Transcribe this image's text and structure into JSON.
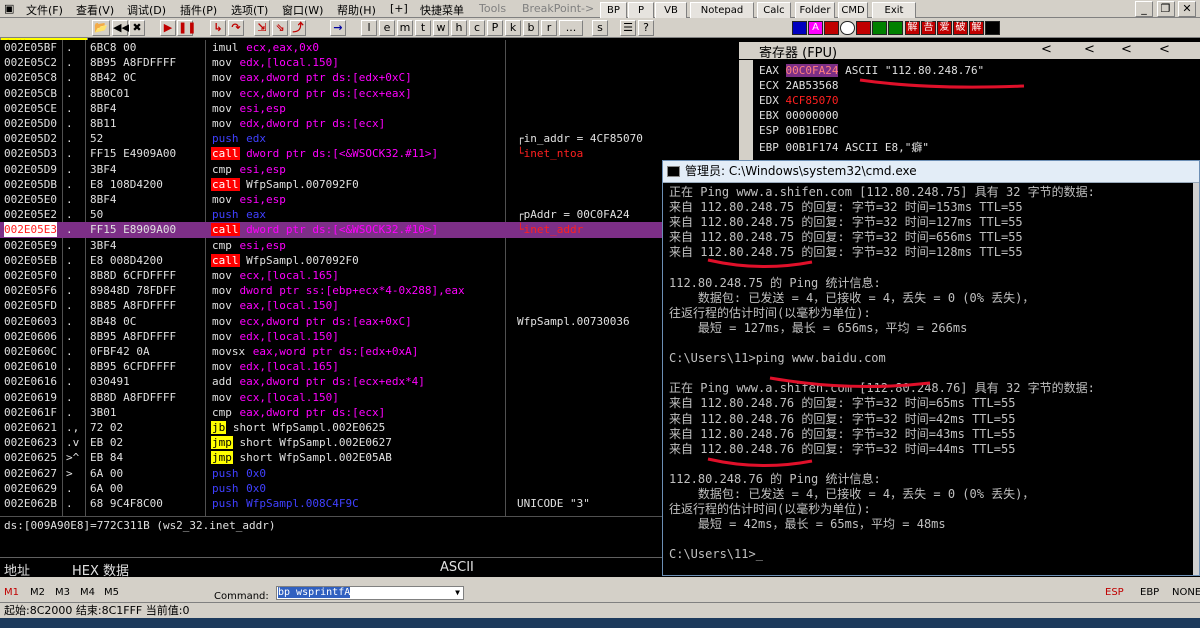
{
  "menubar": {
    "items": [
      "文件(F)",
      "查看(V)",
      "调试(D)",
      "插件(P)",
      "选项(T)",
      "窗口(W)",
      "帮助(H)",
      "[+]",
      "快捷菜单",
      "Tools",
      "BreakPoint->"
    ]
  },
  "toolbar": {
    "pause_label": "暂停",
    "letters": [
      "l",
      "e",
      "m",
      "t",
      "w",
      "h",
      "c",
      "P",
      "k",
      "b",
      "r",
      "...",
      "s"
    ],
    "func_buttons": [
      "BP",
      "P",
      "VB",
      "Notepad",
      "Calc",
      "Folder",
      "CMD",
      "Exit"
    ],
    "color_icons": [
      "#0000c0",
      "#ff00ff",
      "#0060ff",
      "#c00000",
      "#c00000",
      "#008000",
      "#008000",
      "#c00000",
      "#c00000",
      "#c00000",
      "#c00000"
    ],
    "icon_chars": [
      "A",
      "解",
      "吾",
      "爱",
      "破",
      "解"
    ]
  },
  "disasm": {
    "rows": [
      {
        "addr": "002E05BF",
        "mark": ".",
        "hex": "6BC8 00",
        "mn": "imul",
        "ops": "ecx,eax,0x0",
        "style": "k-gray",
        "cmt": ""
      },
      {
        "addr": "002E05C2",
        "mark": ".",
        "hex": "8B95 A8FDFFFF",
        "mn": "mov",
        "ops": "edx,[local.150]",
        "style": "k-gray",
        "cmt": ""
      },
      {
        "addr": "002E05C8",
        "mark": ".",
        "hex": "8B42 0C",
        "mn": "mov",
        "ops": "eax,dword ptr ds:[edx+0xC]",
        "style": "k-gray",
        "cmt": ""
      },
      {
        "addr": "002E05CB",
        "mark": ".",
        "hex": "8B0C01",
        "mn": "mov",
        "ops": "ecx,dword ptr ds:[ecx+eax]",
        "style": "k-gray",
        "cmt": ""
      },
      {
        "addr": "002E05CE",
        "mark": ".",
        "hex": "8BF4",
        "mn": "mov",
        "ops": "esi,esp",
        "style": "k-gray",
        "cmt": ""
      },
      {
        "addr": "002E05D0",
        "mark": ".",
        "hex": "8B11",
        "mn": "mov",
        "ops": "edx,dword ptr ds:[ecx]",
        "style": "k-gray",
        "cmt": ""
      },
      {
        "addr": "002E05D2",
        "mark": ".",
        "hex": "52",
        "mn": "push",
        "ops": "edx",
        "style": "k-push",
        "cmt": "┌in_addr = 4CF85070"
      },
      {
        "addr": "002E05D3",
        "mark": ".",
        "hex": "FF15 E4909A00",
        "mn": "call",
        "ops": "dword ptr ds:[<&WSOCK32.#11>]",
        "style": "k-call",
        "cmt": "└inet_ntoa"
      },
      {
        "addr": "002E05D9",
        "mark": ".",
        "hex": "3BF4",
        "mn": "cmp",
        "ops": "esi,esp",
        "style": "k-gray",
        "cmt": ""
      },
      {
        "addr": "002E05DB",
        "mark": ".",
        "hex": "E8 108D4200",
        "mn": "call",
        "ops": "WfpSampl.007092F0",
        "style": "k-call",
        "cmt": ""
      },
      {
        "addr": "002E05E0",
        "mark": ".",
        "hex": "8BF4",
        "mn": "mov",
        "ops": "esi,esp",
        "style": "k-gray",
        "cmt": ""
      },
      {
        "addr": "002E05E2",
        "mark": ".",
        "hex": "50",
        "mn": "push",
        "ops": "eax",
        "style": "k-push",
        "cmt": "┌pAddr = 00C0FA24"
      },
      {
        "addr": "002E05E3",
        "mark": ".",
        "hex": "FF15 E8909A00",
        "mn": "call",
        "ops": "dword ptr ds:[<&WSOCK32.#10>]",
        "style": "k-call",
        "cmt": "└inet_addr",
        "sel": true
      },
      {
        "addr": "002E05E9",
        "mark": ".",
        "hex": "3BF4",
        "mn": "cmp",
        "ops": "esi,esp",
        "style": "k-gray",
        "cmt": ""
      },
      {
        "addr": "002E05EB",
        "mark": ".",
        "hex": "E8 008D4200",
        "mn": "call",
        "ops": "WfpSampl.007092F0",
        "style": "k-call",
        "cmt": ""
      },
      {
        "addr": "002E05F0",
        "mark": ".",
        "hex": "8B8D 6CFDFFFF",
        "mn": "mov",
        "ops": "ecx,[local.165]",
        "style": "k-gray",
        "cmt": ""
      },
      {
        "addr": "002E05F6",
        "mark": ".",
        "hex": "89848D 78FDFF",
        "mn": "mov",
        "ops": "dword ptr ss:[ebp+ecx*4-0x288],eax",
        "style": "k-gray",
        "cmt": ""
      },
      {
        "addr": "002E05FD",
        "mark": ".",
        "hex": "8B85 A8FDFFFF",
        "mn": "mov",
        "ops": "eax,[local.150]",
        "style": "k-gray",
        "cmt": ""
      },
      {
        "addr": "002E0603",
        "mark": ".",
        "hex": "8B48 0C",
        "mn": "mov",
        "ops": "ecx,dword ptr ds:[eax+0xC]",
        "style": "k-gray",
        "cmt": "WfpSampl.00730036"
      },
      {
        "addr": "002E0606",
        "mark": ".",
        "hex": "8B95 A8FDFFFF",
        "mn": "mov",
        "ops": "edx,[local.150]",
        "style": "k-gray",
        "cmt": ""
      },
      {
        "addr": "002E060C",
        "mark": ".",
        "hex": "0FBF42 0A",
        "mn": "movsx",
        "ops": "eax,word ptr ds:[edx+0xA]",
        "style": "k-gray",
        "cmt": ""
      },
      {
        "addr": "002E0610",
        "mark": ".",
        "hex": "8B95 6CFDFFFF",
        "mn": "mov",
        "ops": "edx,[local.165]",
        "style": "k-gray",
        "cmt": ""
      },
      {
        "addr": "002E0616",
        "mark": ".",
        "hex": "030491",
        "mn": "add",
        "ops": "eax,dword ptr ds:[ecx+edx*4]",
        "style": "k-gray",
        "cmt": ""
      },
      {
        "addr": "002E0619",
        "mark": ".",
        "hex": "8B8D A8FDFFFF",
        "mn": "mov",
        "ops": "ecx,[local.150]",
        "style": "k-gray",
        "cmt": ""
      },
      {
        "addr": "002E061F",
        "mark": ".",
        "hex": "3B01",
        "mn": "cmp",
        "ops": "eax,dword ptr ds:[ecx]",
        "style": "k-gray",
        "cmt": ""
      },
      {
        "addr": "002E0621",
        "mark": ".,",
        "hex": "72 02",
        "mn": "jb",
        "ops": "short WfpSampl.002E0625",
        "style": "k-jb",
        "cmt": ""
      },
      {
        "addr": "002E0623",
        "mark": ".v",
        "hex": "EB 02",
        "mn": "jmp",
        "ops": "short WfpSampl.002E0627",
        "style": "k-jmp",
        "cmt": ""
      },
      {
        "addr": "002E0625",
        "mark": ">^",
        "hex": "EB 84",
        "mn": "jmp",
        "ops": "short WfpSampl.002E05AB",
        "style": "k-jmp",
        "cmt": ""
      },
      {
        "addr": "002E0627",
        "mark": ">",
        "hex": "6A 00",
        "mn": "push",
        "ops": "0x0",
        "style": "k-push",
        "cmt": ""
      },
      {
        "addr": "002E0629",
        "mark": ".",
        "hex": "6A 00",
        "mn": "push",
        "ops": "0x0",
        "style": "k-push",
        "cmt": ""
      },
      {
        "addr": "002E062B",
        "mark": ".",
        "hex": "68 9C4F8C00",
        "mn": "push",
        "ops": "WfpSampl.008C4F9C",
        "style": "k-push",
        "cmt": "UNICODE \"3\""
      }
    ]
  },
  "info": {
    "line1": "ds:[009A90E8]=772C311B (ws2_32.inet_addr)"
  },
  "dump": {
    "col_addr": "地址",
    "col_hex": "HEX 数据",
    "col_ascii": "ASCII"
  },
  "registers": {
    "title": "寄存器 (FPU)",
    "rows": [
      {
        "name": "EAX",
        "value": "00C0FA24",
        "extra": "ASCII \"112.80.248.76\"",
        "vstyle": "sel"
      },
      {
        "name": "ECX",
        "value": "2AB53568",
        "extra": "",
        "vstyle": ""
      },
      {
        "name": "EDX",
        "value": "4CF85070",
        "extra": "",
        "vstyle": "red"
      },
      {
        "name": "EBX",
        "value": "00000000",
        "extra": "",
        "vstyle": ""
      },
      {
        "name": "ESP",
        "value": "00B1EDBC",
        "extra": "",
        "vstyle": ""
      },
      {
        "name": "EBP",
        "value": "00B1F174",
        "extra": "ASCII E8,\"癖\"",
        "vstyle": ""
      }
    ]
  },
  "cmd": {
    "title": "管理员: C:\\Windows\\system32\\cmd.exe",
    "lines": [
      "正在 Ping www.a.shifen.com [112.80.248.75] 具有 32 字节的数据:",
      "来自 112.80.248.75 的回复: 字节=32 时间=153ms TTL=55",
      "来自 112.80.248.75 的回复: 字节=32 时间=127ms TTL=55",
      "来自 112.80.248.75 的回复: 字节=32 时间=656ms TTL=55",
      "来自 112.80.248.75 的回复: 字节=32 时间=128ms TTL=55",
      "",
      "112.80.248.75 的 Ping 统计信息:",
      "    数据包: 已发送 = 4，已接收 = 4，丢失 = 0 (0% 丢失)，",
      "往返行程的估计时间(以毫秒为单位):",
      "    最短 = 127ms，最长 = 656ms，平均 = 266ms",
      "",
      "C:\\Users\\11>ping www.baidu.com",
      "",
      "正在 Ping www.a.shifen.com [112.80.248.76] 具有 32 字节的数据:",
      "来自 112.80.248.76 的回复: 字节=32 时间=65ms TTL=55",
      "来自 112.80.248.76 的回复: 字节=32 时间=42ms TTL=55",
      "来自 112.80.248.76 的回复: 字节=32 时间=43ms TTL=55",
      "来自 112.80.248.76 的回复: 字节=32 时间=44ms TTL=55",
      "",
      "112.80.248.76 的 Ping 统计信息:",
      "    数据包: 已发送 = 4，已接收 = 4，丢失 = 0 (0% 丢失)，",
      "往返行程的估计时间(以毫秒为单位):",
      "    最短 = 42ms，最长 = 65ms，平均 = 48ms",
      "",
      "C:\\Users\\11>_"
    ]
  },
  "bottom": {
    "mtabs": [
      "M1",
      "M2",
      "M3",
      "M4",
      "M5"
    ],
    "command_label": "Command:",
    "command_value": "bp wsprintfA",
    "right_regs": [
      "ESP",
      "EBP",
      "NONE"
    ]
  },
  "status": {
    "text": "起始:8C2000 结束:8C1FFF 当前值:0"
  },
  "colors": {
    "accent": "#7d2f87",
    "call": "#ff0000",
    "push": "#4040ff",
    "jmp": "#ffff00",
    "annotation": "#e0102a"
  }
}
